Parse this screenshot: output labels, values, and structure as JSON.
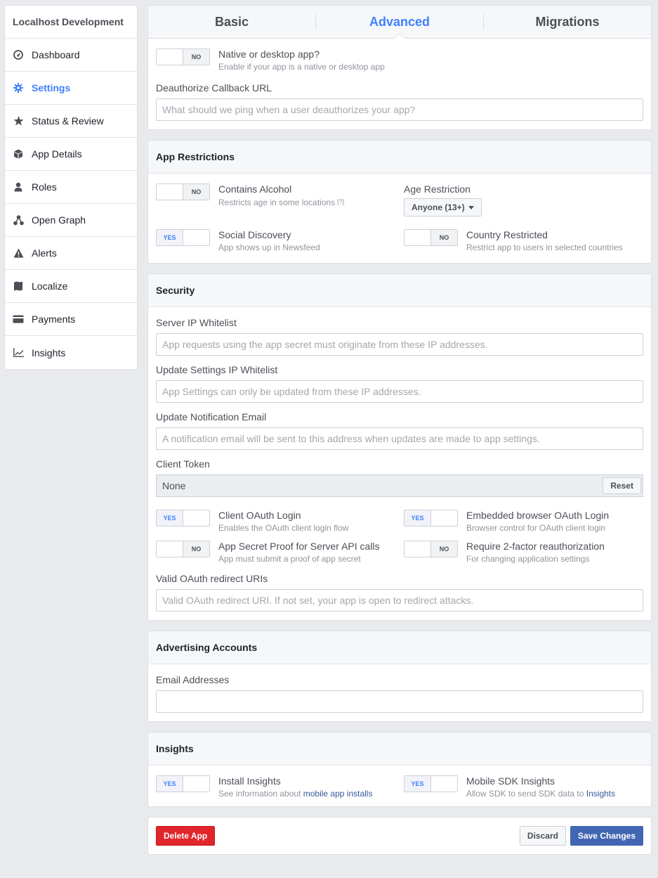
{
  "sidebar": {
    "app_title": "Localhost Development",
    "items": [
      {
        "label": "Dashboard",
        "icon": "dashboard-icon"
      },
      {
        "label": "Settings",
        "icon": "gear-icon"
      },
      {
        "label": "Status & Review",
        "icon": "star-icon"
      },
      {
        "label": "App Details",
        "icon": "cube-icon"
      },
      {
        "label": "Roles",
        "icon": "person-icon"
      },
      {
        "label": "Open Graph",
        "icon": "graph-icon"
      },
      {
        "label": "Alerts",
        "icon": "warning-icon"
      },
      {
        "label": "Localize",
        "icon": "flag-icon"
      },
      {
        "label": "Payments",
        "icon": "credit-card-icon"
      },
      {
        "label": "Insights",
        "icon": "chart-icon"
      }
    ],
    "active_item": "Settings"
  },
  "tabs": [
    "Basic",
    "Advanced",
    "Migrations"
  ],
  "active_tab": "Advanced",
  "top": {
    "native": {
      "title": "Native or desktop app?",
      "sub": "Enable if your app is a native or desktop app",
      "state": "NO"
    },
    "deauth_label": "Deauthorize Callback URL",
    "deauth_placeholder": "What should we ping when a user deauthorizes your app?"
  },
  "restrictions": {
    "header": "App Restrictions",
    "alcohol": {
      "title": "Contains Alcohol",
      "sub": "Restricts age in some locations",
      "help": "[?]",
      "state": "NO"
    },
    "age_label": "Age Restriction",
    "age_value": "Anyone (13+)",
    "social": {
      "title": "Social Discovery",
      "sub": "App shows up in Newsfeed",
      "state": "YES"
    },
    "country": {
      "title": "Country Restricted",
      "sub": "Restrict app to users in selected countries",
      "state": "NO"
    }
  },
  "security": {
    "header": "Security",
    "server_ip_label": "Server IP Whitelist",
    "server_ip_placeholder": "App requests using the app secret must originate from these IP addresses.",
    "settings_ip_label": "Update Settings IP Whitelist",
    "settings_ip_placeholder": "App Settings can only be updated from these IP addresses.",
    "notif_label": "Update Notification Email",
    "notif_placeholder": "A notification email will be sent to this address when updates are made to app settings.",
    "token_label": "Client Token",
    "token_value": "None",
    "reset_label": "Reset",
    "client_oauth": {
      "title": "Client OAuth Login",
      "sub": "Enables the OAuth client login flow",
      "state": "YES"
    },
    "embedded_oauth": {
      "title": "Embedded browser OAuth Login",
      "sub": "Browser control for OAuth client login",
      "state": "YES"
    },
    "secret_proof": {
      "title": "App Secret Proof for Server API calls",
      "sub": "App must submit a proof of app secret",
      "state": "NO"
    },
    "two_factor": {
      "title": "Require 2-factor reauthorization",
      "sub": "For changing application settings",
      "state": "NO"
    },
    "redirect_label": "Valid OAuth redirect URIs",
    "redirect_placeholder": "Valid OAuth redirect URI. If not set, your app is open to redirect attacks."
  },
  "advertising": {
    "header": "Advertising Accounts",
    "email_label": "Email Addresses",
    "email_value": ""
  },
  "insights": {
    "header": "Insights",
    "install": {
      "title": "Install Insights",
      "sub_prefix": "See information about ",
      "sub_link": "mobile app installs",
      "state": "YES"
    },
    "mobile": {
      "title": "Mobile SDK Insights",
      "sub_prefix": "Allow SDK to send SDK data to ",
      "sub_link": "Insights",
      "state": "YES"
    }
  },
  "footer": {
    "delete_label": "Delete App",
    "discard_label": "Discard",
    "save_label": "Save Changes"
  },
  "toggle_labels": {
    "yes": "YES",
    "no": "NO"
  },
  "colors": {
    "accent": "#4080ff",
    "delete": "#e0262b",
    "save": "#4267b2",
    "link": "#365899"
  }
}
